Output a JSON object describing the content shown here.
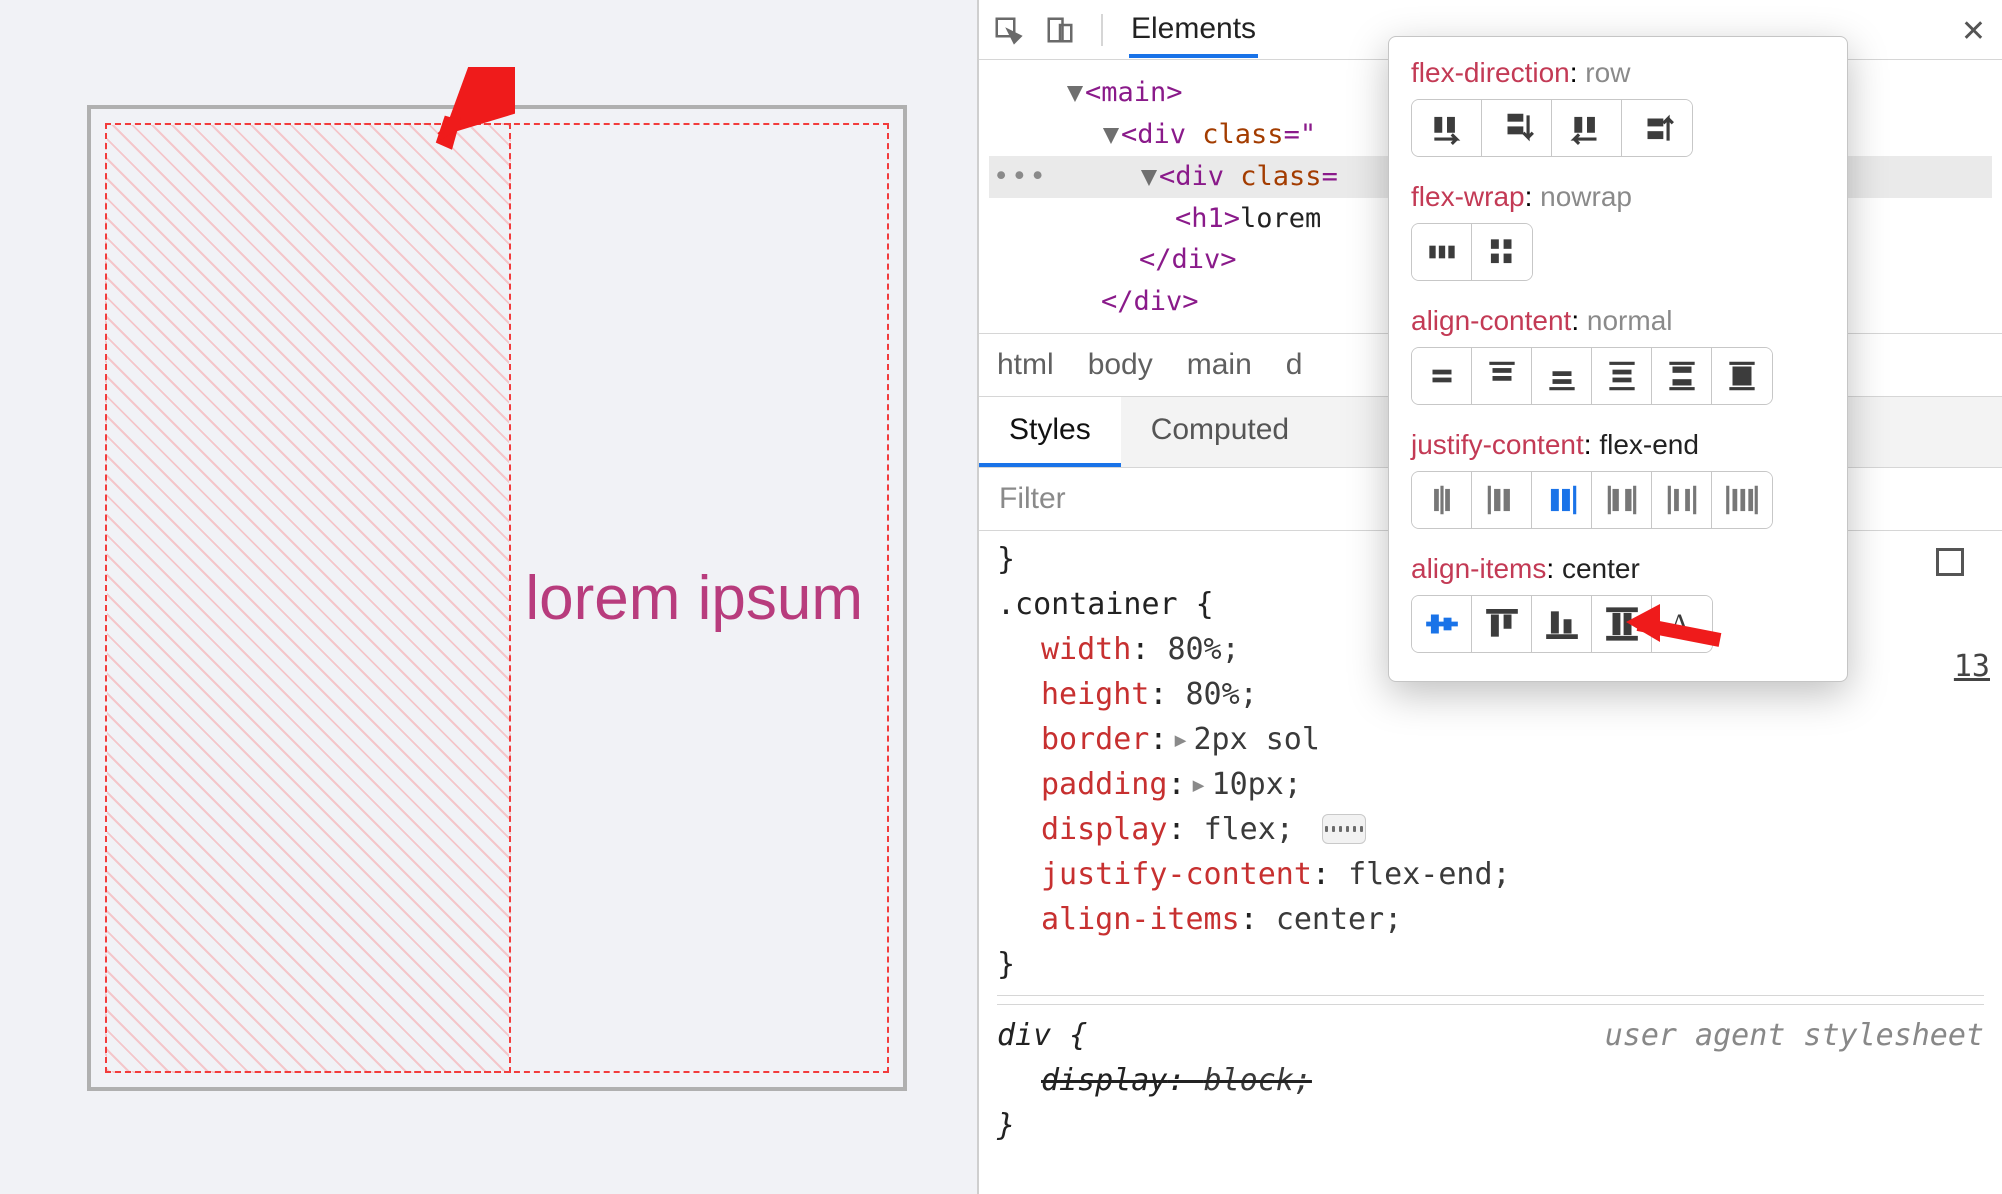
{
  "preview": {
    "heading": "lorem ipsum"
  },
  "devtools": {
    "tab": "Elements",
    "dom": {
      "main_open": "<main>",
      "div1_open": "<div class=\"",
      "div2_open": "<div class=",
      "h1_open": "<h1>",
      "h1_text": "lorem",
      "div_close": "</div>",
      "div_close2": "</div>"
    },
    "crumbs": [
      "html",
      "body",
      "main",
      "d"
    ],
    "style_tabs": {
      "styles": "Styles",
      "computed": "Computed"
    },
    "filter_placeholder": "Filter",
    "css": {
      "selector": ".container {",
      "width": {
        "prop": "width",
        "val": "80%;"
      },
      "height": {
        "prop": "height",
        "val": "80%;"
      },
      "border": {
        "prop": "border",
        "val": "2px sol"
      },
      "padding": {
        "prop": "padding",
        "val": "10px;"
      },
      "display": {
        "prop": "display",
        "val": "flex;"
      },
      "justify": {
        "prop": "justify-content",
        "val": "flex-end;"
      },
      "align": {
        "prop": "align-items",
        "val": "center;"
      },
      "close": "}",
      "ua_selector": "div {",
      "ua_display": {
        "prop": "display",
        "val": "block;"
      },
      "ua_close": "}",
      "ua_label": "user agent stylesheet"
    },
    "link_line": "13"
  },
  "popover": {
    "flex_direction": {
      "key": "flex-direction",
      "val": "row"
    },
    "flex_wrap": {
      "key": "flex-wrap",
      "val": "nowrap"
    },
    "align_content": {
      "key": "align-content",
      "val": "normal"
    },
    "justify_content": {
      "key": "justify-content",
      "val": "flex-end"
    },
    "align_items": {
      "key": "align-items",
      "val": "center"
    }
  }
}
